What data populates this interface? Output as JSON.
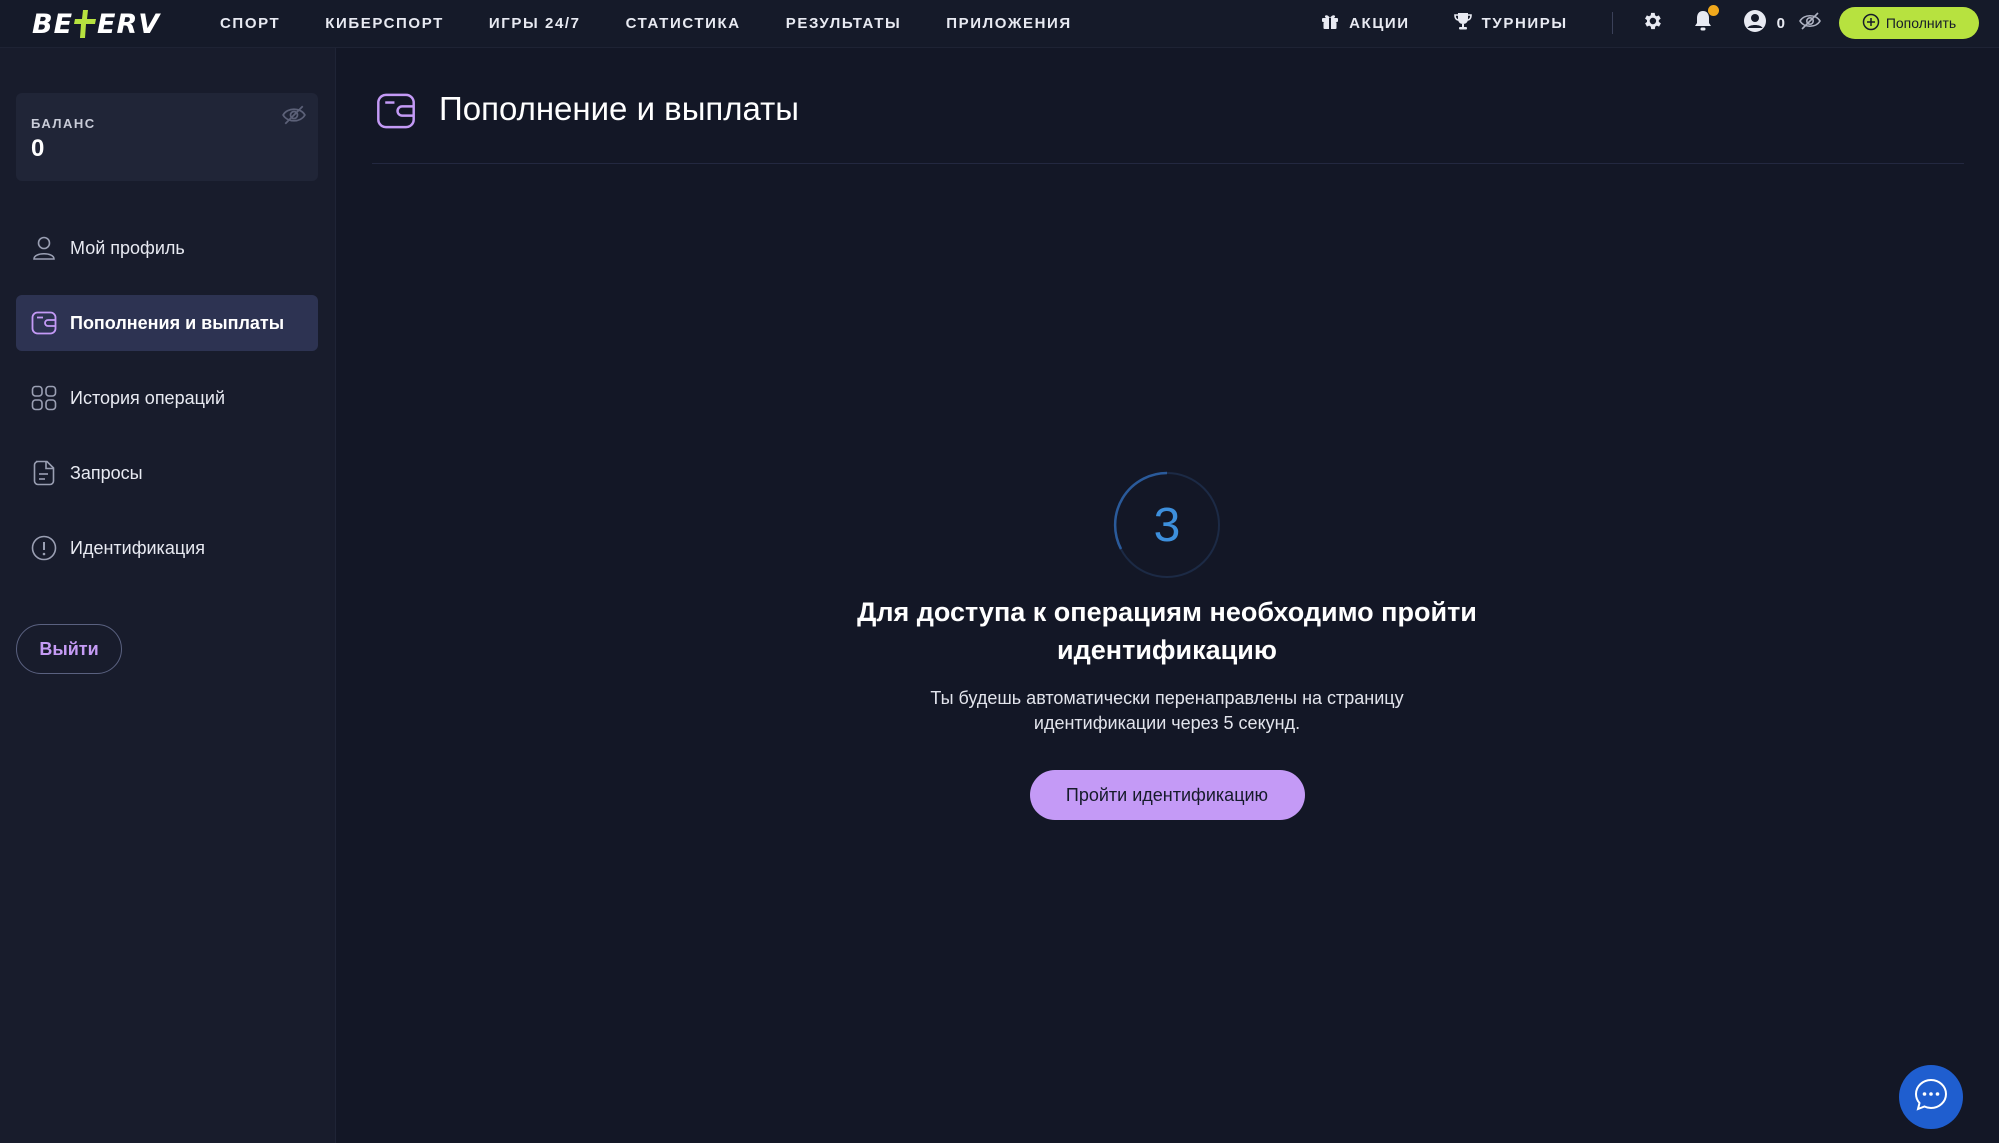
{
  "brand": {
    "logo_left": "BE",
    "logo_right": "ERV",
    "accent": "#b7e23f"
  },
  "nav": {
    "items": [
      "СПОРТ",
      "КИБЕРСПОРТ",
      "ИГРЫ 24/7",
      "СТАТИСТИКА",
      "РЕЗУЛЬТАТЫ",
      "ПРИЛОЖЕНИЯ"
    ]
  },
  "topbar": {
    "promo_label": "АКЦИИ",
    "tournaments_label": "ТУРНИРЫ",
    "account_balance": "0",
    "deposit_label": "Пополнить",
    "icons": [
      "gift-icon",
      "trophy-icon",
      "gear-icon",
      "bell-icon",
      "user-icon",
      "eye-off-icon",
      "plus-circle-icon"
    ]
  },
  "sidebar": {
    "balance_label": "БАЛАНС",
    "balance_value": "0",
    "items": [
      {
        "label": "Мой профиль",
        "icon": "user-icon",
        "active": false
      },
      {
        "label": "Пополнения и выплаты",
        "icon": "wallet-icon",
        "active": true
      },
      {
        "label": "История операций",
        "icon": "grid-icon",
        "active": false
      },
      {
        "label": "Запросы",
        "icon": "document-icon",
        "active": false
      },
      {
        "label": "Идентификация",
        "icon": "alert-circle-icon",
        "active": false
      }
    ],
    "logout_label": "Выйти"
  },
  "main": {
    "title": "Пополнение и выплаты",
    "countdown": "3",
    "message_title": "Для доступа к операциям необходимо пройти идентификацию",
    "message_sub": "Ты будешь автоматически перенаправлены на страницу идентификации через 5 секунд.",
    "verify_label": "Пройти идентификацию"
  },
  "colors": {
    "background": "#131726",
    "sidebar": "#181c2c",
    "active_item": "#2d3352",
    "purple": "#c49af6",
    "countdown_blue": "#3d8fdc",
    "chat_blue": "#1f5ecf",
    "notification_dot": "#f0a81c"
  }
}
